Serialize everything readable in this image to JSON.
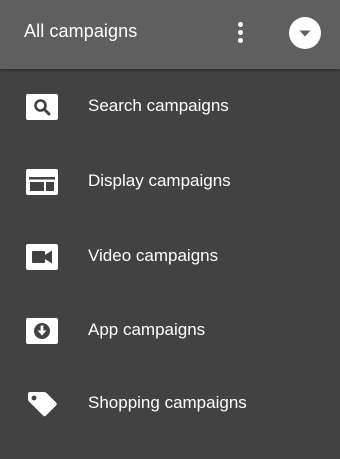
{
  "header": {
    "title": "All campaigns",
    "more_icon": "more-vertical-icon",
    "dropdown_icon": "chevron-down-icon"
  },
  "menu": {
    "items": [
      {
        "label": "Search campaigns",
        "icon": "search-icon"
      },
      {
        "label": "Display campaigns",
        "icon": "display-layout-icon"
      },
      {
        "label": "Video campaigns",
        "icon": "video-camera-icon"
      },
      {
        "label": "App campaigns",
        "icon": "download-app-icon"
      },
      {
        "label": "Shopping campaigns",
        "icon": "tag-icon"
      }
    ]
  },
  "colors": {
    "header_bg": "#5f5f5f",
    "menu_bg": "#424242",
    "text": "#ffffff",
    "icon_fg": "#424242"
  }
}
